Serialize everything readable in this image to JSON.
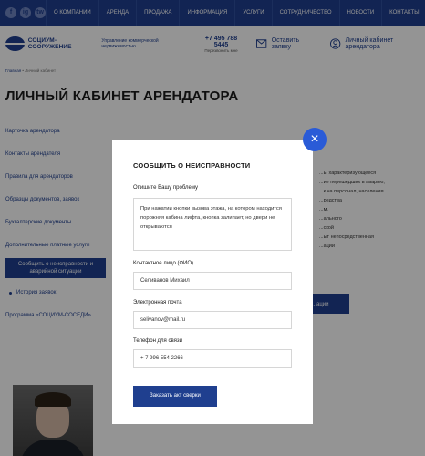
{
  "topbar": {
    "socials": [
      "f",
      "ig",
      "tw"
    ],
    "nav": [
      "О КОМПАНИИ",
      "АРЕНДА",
      "ПРОДАЖА",
      "ИНФОРМАЦИЯ",
      "УСЛУГИ",
      "СОТРУДНИЧЕСТВО",
      "НОВОСТИ",
      "КОНТАКТЫ"
    ]
  },
  "header": {
    "logo_text": "СОЦИУМ-СООРУЖЕНИЕ",
    "tagline": "Управление коммерческой недвижимостью",
    "phone": "+7 495 788 5445",
    "callback_small": "Перезвонить мне",
    "leave_request": "Оставить заявку",
    "cabinet": "Личный кабинет арендатора"
  },
  "breadcrumb": {
    "home": "Главная",
    "current": "Личный кабинет"
  },
  "page": {
    "title": "ЛИЧНЫЙ КАБИНЕТ АРЕНДАТОРА"
  },
  "side_menu": {
    "items": [
      "Карточка арендатора",
      "Контакты арендателя",
      "Правила для арендаторов",
      "Образцы документов, заявок",
      "Бухгалтерские документы",
      "Дополнительные платные услуги"
    ],
    "active": "Сообщить о неисправности и аварийной ситуации",
    "sub": "История заявок",
    "program": "Программа «СОЦИУМ-СОСЕДИ»"
  },
  "right_text": [
    "...ь, характеризующееся",
    "...ие перешедших в аварию,",
    "...к на персонал, населения",
    "...редства",
    "...м.",
    "...ального",
    "...ской",
    "...ыт непосредственная",
    "...ации"
  ],
  "right_button_label": "...ации",
  "modal": {
    "close_glyph": "×",
    "title": "СООБЩИТЬ О НЕИСПРАВНОСТИ",
    "problem_label": "Опишите Вашу проблему",
    "problem_text": "При нажатии кнопки вызова этажа, на котором находится порожняя кабина лифта, кнопка залипает, но двери не открываются",
    "contact_label": "Контактное лицо (ФИО)",
    "contact_value": "Селиванов Михаил",
    "email_label": "Электронная почта",
    "email_value": "selivanov@mail.ru",
    "phone_label": "Телефон для связи",
    "phone_value": "+ 7 996 554 2266",
    "submit_label": "Заказать акт сверки"
  }
}
